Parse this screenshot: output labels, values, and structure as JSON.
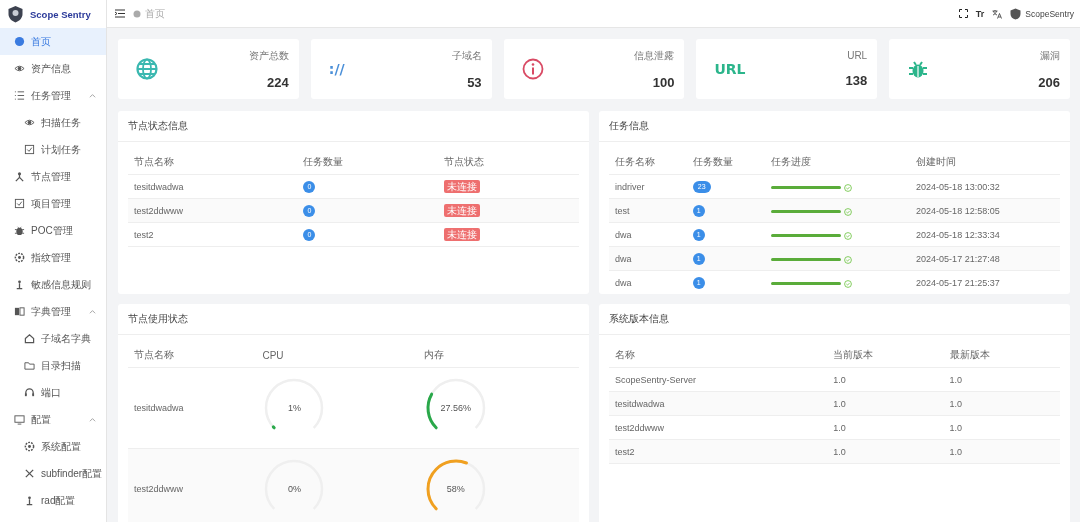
{
  "brand": {
    "name": "Scope Sentry"
  },
  "sidebar": {
    "items": [
      {
        "label": "首页",
        "selected": true
      },
      {
        "label": "资产信息",
        "selected": false
      },
      {
        "label": "任务管理",
        "selected": false,
        "expanded": true,
        "children": [
          {
            "label": "扫描任务",
            "selected": false
          },
          {
            "label": "计划任务",
            "selected": false
          }
        ]
      },
      {
        "label": "节点管理",
        "selected": false
      },
      {
        "label": "项目管理",
        "selected": false
      },
      {
        "label": "POC管理",
        "selected": false
      },
      {
        "label": "指纹管理",
        "selected": false
      },
      {
        "label": "敏感信息规则",
        "selected": false
      },
      {
        "label": "字典管理",
        "selected": false,
        "expanded": true,
        "children": [
          {
            "label": "子域名字典",
            "selected": false
          },
          {
            "label": "目录扫描",
            "selected": false
          },
          {
            "label": "端口",
            "selected": false
          }
        ]
      },
      {
        "label": "配置",
        "selected": false,
        "expanded": true,
        "children": [
          {
            "label": "系统配置",
            "selected": false
          },
          {
            "label": "subfinder配置",
            "selected": false
          },
          {
            "label": "rad配置",
            "selected": false
          }
        ]
      }
    ]
  },
  "topbar": {
    "breadcrumb": "首页",
    "font_size_label": "Tr",
    "user": "ScopeSentry"
  },
  "stats": [
    {
      "label": "资产总数",
      "value": "224"
    },
    {
      "label": "子域名",
      "value": "53",
      "icon_text": "://"
    },
    {
      "label": "信息泄露",
      "value": "100"
    },
    {
      "label": "URL",
      "value": "138",
      "icon_text": "URL"
    },
    {
      "label": "漏洞",
      "value": "206"
    }
  ],
  "node_status": {
    "title": "节点状态信息",
    "columns": [
      "节点名称",
      "任务数量",
      "节点状态"
    ],
    "rows": [
      {
        "name": "tesitdwadwa",
        "tasks": "0",
        "status": "未连接",
        "connected": false
      },
      {
        "name": "test2ddwww",
        "tasks": "0",
        "status": "未连接",
        "connected": false
      },
      {
        "name": "test2",
        "tasks": "0",
        "status": "未连接",
        "connected": false
      }
    ]
  },
  "task_info": {
    "title": "任务信息",
    "columns": [
      "任务名称",
      "任务数量",
      "任务进度",
      "创建时间"
    ],
    "rows": [
      {
        "name": "indriver",
        "count": "23",
        "level": 1,
        "created": "2024-05-18 13:00:32"
      },
      {
        "name": "test",
        "count": "1",
        "level": 1,
        "created": "2024-05-18 12:58:05"
      },
      {
        "name": "dwa",
        "count": "1",
        "level": 1,
        "created": "2024-05-18 12:33:34"
      },
      {
        "name": "dwa",
        "count": "1",
        "level": 1,
        "created": "2024-05-17 21:27:48"
      },
      {
        "name": "dwa",
        "count": "1",
        "level": 1,
        "created": "2024-05-17 21:25:37"
      }
    ]
  },
  "node_usage": {
    "title": "节点使用状态",
    "columns": [
      "节点名称",
      "CPU",
      "内存"
    ],
    "rows": [
      {
        "name": "tesitdwadwa",
        "cpu": {
          "level": 0.01,
          "reading": "1%"
        },
        "memory": {
          "level": 0.2756,
          "reading": "27.56%",
          "color": "#2aa84a"
        }
      },
      {
        "name": "test2ddwww",
        "cpu": {
          "reading": "0%"
        },
        "memory": {
          "level": 0.58,
          "reading": "58%",
          "color": "#f0a020"
        }
      }
    ]
  },
  "versions": {
    "title": "系统版本信息",
    "columns": [
      "名称",
      "当前版本",
      "最新版本"
    ],
    "rows": [
      {
        "name": "ScopeSentry-Server",
        "current": "1.0",
        "latest": "1.0"
      },
      {
        "name": "tesitdwadwa",
        "current": "1.0",
        "latest": "1.0"
      },
      {
        "name": "test2ddwww",
        "current": "1.0",
        "latest": "1.0"
      },
      {
        "name": "test2",
        "current": "1.0",
        "latest": "1.0"
      }
    ]
  }
}
